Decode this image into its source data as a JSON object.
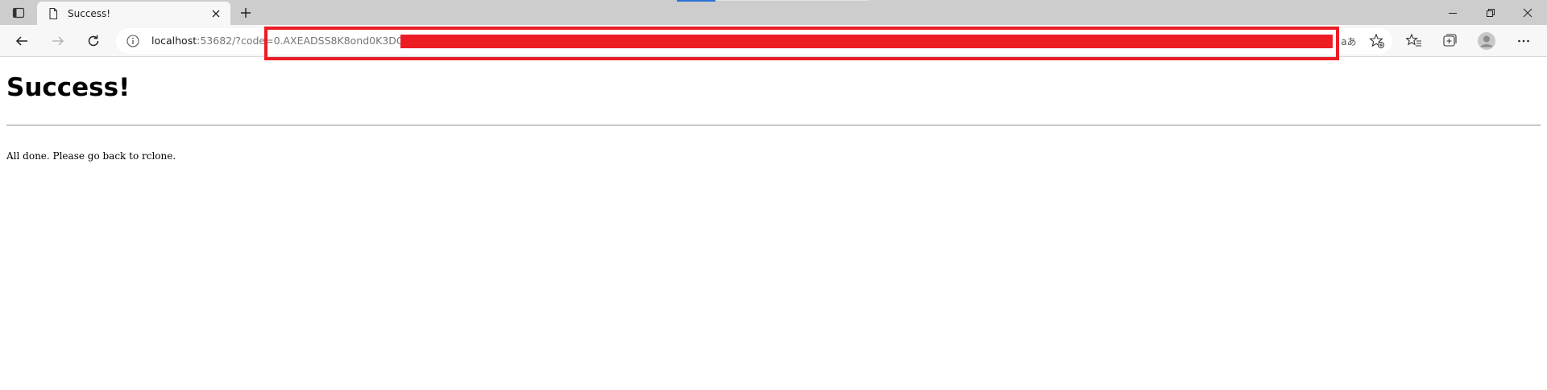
{
  "browser": {
    "tab": {
      "title": "Success!"
    },
    "address_bar": {
      "url_host": "localhost",
      "url_rest": ":53682/?code=0.AXEADSS8K8ond0K3DG",
      "read_aloud_label": "aあ"
    },
    "icons": {
      "tab_actions": "tab-actions-icon",
      "page": "page-icon",
      "close": "close-icon",
      "new_tab": "plus-icon",
      "back": "back-arrow-icon",
      "forward": "forward-arrow-icon",
      "refresh": "refresh-icon",
      "site_info": "info-icon",
      "add_favorite": "star-plus-icon",
      "favorites": "favorites-icon",
      "collections": "collections-icon",
      "profile": "avatar-icon",
      "more": "more-icon"
    },
    "colors": {
      "annotation_red": "#ec1c24",
      "tab_strip": "#cdcdcd",
      "toolbar": "#f7f7f7"
    }
  },
  "page": {
    "heading": "Success!",
    "message": "All done. Please go back to rclone."
  }
}
